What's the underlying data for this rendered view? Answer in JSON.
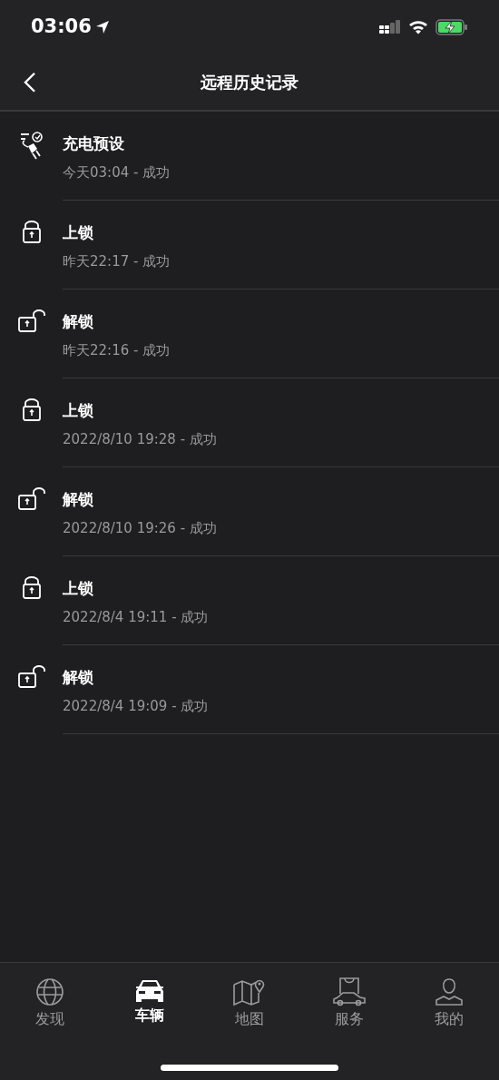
{
  "status_bar": {
    "time": "03:06"
  },
  "header": {
    "title": "远程历史记录"
  },
  "records": [
    {
      "kind": "charge",
      "title": "充电预设",
      "detail": "今天03:04 - 成功"
    },
    {
      "kind": "lock",
      "title": "上锁",
      "detail": "昨天22:17 - 成功"
    },
    {
      "kind": "unlock",
      "title": "解锁",
      "detail": "昨天22:16 - 成功"
    },
    {
      "kind": "lock",
      "title": "上锁",
      "detail": "2022/8/10 19:28 - 成功"
    },
    {
      "kind": "unlock",
      "title": "解锁",
      "detail": "2022/8/10 19:26 - 成功"
    },
    {
      "kind": "lock",
      "title": "上锁",
      "detail": "2022/8/4 19:11 - 成功"
    },
    {
      "kind": "unlock",
      "title": "解锁",
      "detail": "2022/8/4 19:09 - 成功"
    }
  ],
  "tab_bar": [
    {
      "kind": "globe",
      "label": "发现",
      "selected": false
    },
    {
      "kind": "car",
      "label": "车辆",
      "selected": true
    },
    {
      "kind": "map",
      "label": "地图",
      "selected": false
    },
    {
      "kind": "service",
      "label": "服务",
      "selected": false
    },
    {
      "kind": "person",
      "label": "我的",
      "selected": false
    }
  ]
}
